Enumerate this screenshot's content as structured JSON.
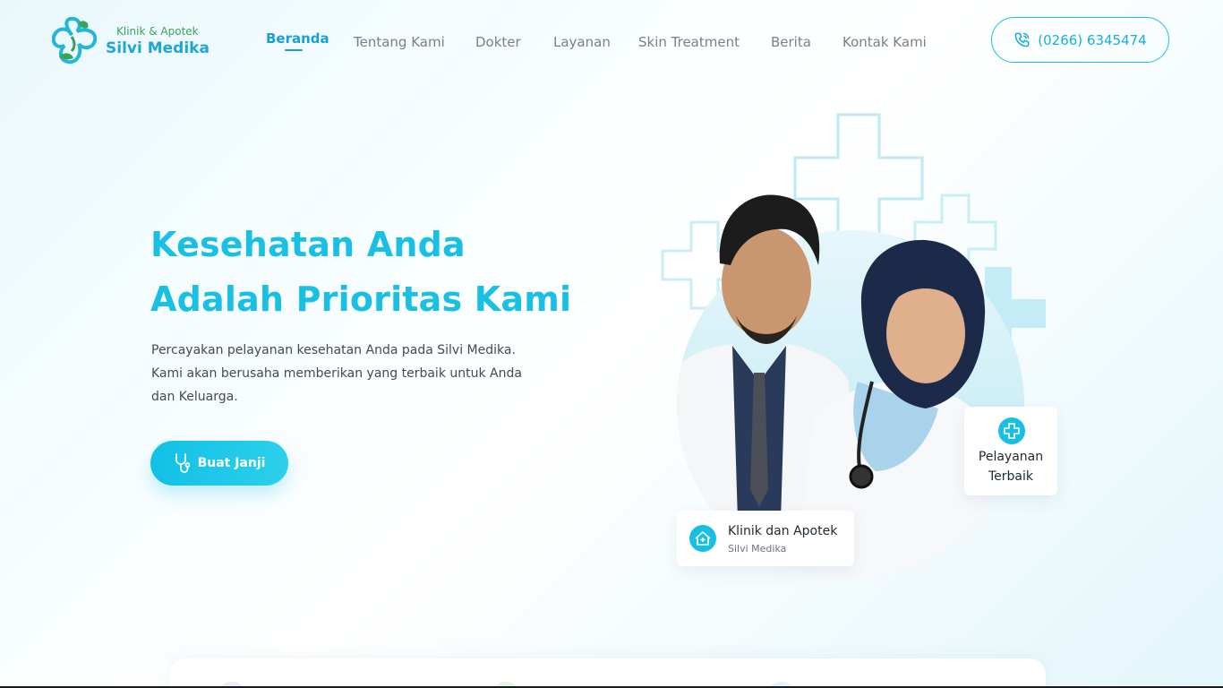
{
  "brand": {
    "tagline": "Klinik & Apotek",
    "name": "Silvi Medika",
    "primary_color": "#19c0e4",
    "secondary_color": "#3aa35a"
  },
  "nav": {
    "items": [
      {
        "label": "Beranda",
        "active": true
      },
      {
        "label": "Tentang Kami",
        "active": false
      },
      {
        "label": "Dokter",
        "active": false
      },
      {
        "label": "Layanan",
        "active": false
      },
      {
        "label": "Skin Treatment",
        "active": false
      },
      {
        "label": "Berita",
        "active": false
      },
      {
        "label": "Kontak Kami",
        "active": false
      }
    ],
    "phone": "(0266) 6345474",
    "phone_icon": "phone-icon"
  },
  "hero": {
    "title_line1": "Kesehatan Anda",
    "title_line2": "Adalah Prioritas Kami",
    "description_line1": "Percayakan pelayanan kesehatan Anda pada Silvi Medika.",
    "description_line2": "Kami akan berusaha memberikan yang terbaik untuk Anda",
    "description_line3": "dan Keluarga.",
    "cta_label": "Buat Janji",
    "cta_icon": "stethoscope-icon"
  },
  "badges": {
    "service": {
      "line1": "Pelayanan",
      "line2": "Terbaik",
      "icon": "medical-cross-icon"
    },
    "clinic": {
      "title": "Klinik dan Apotek",
      "subtitle": "Silvi Medika",
      "icon": "home-medical-icon"
    }
  }
}
